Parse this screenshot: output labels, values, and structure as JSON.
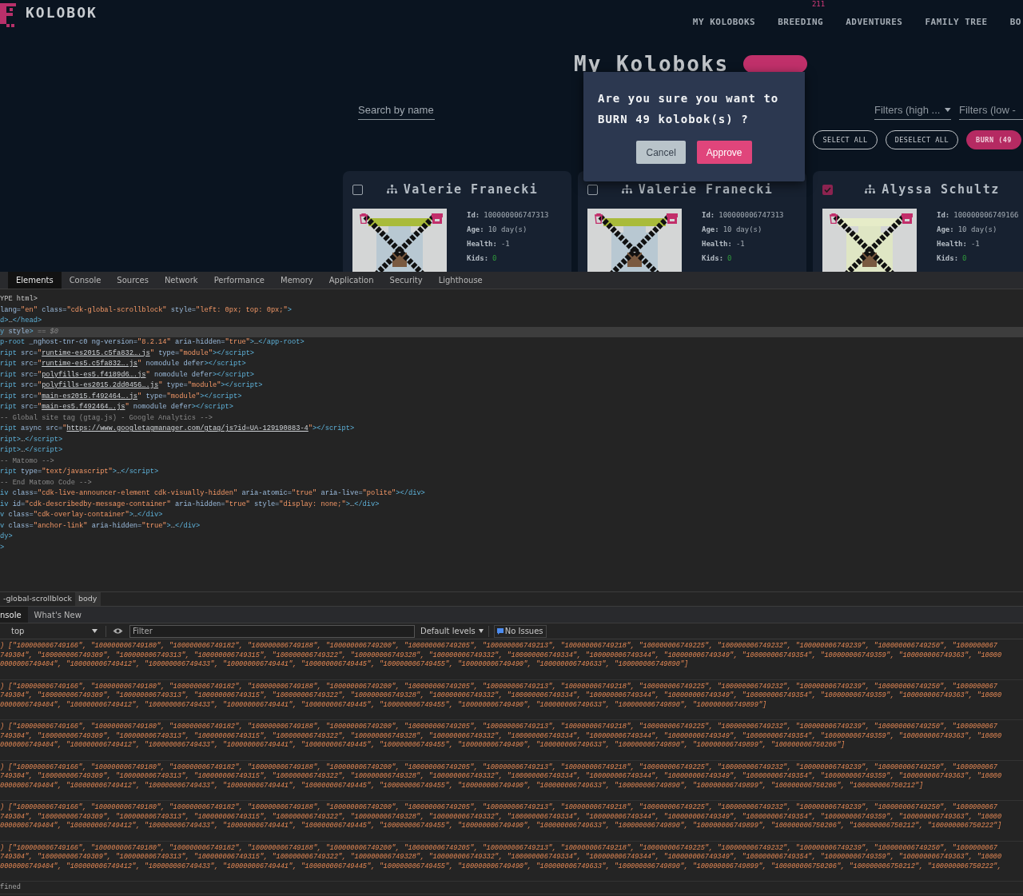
{
  "app": {
    "logo": "KOLOBOK",
    "nav": [
      {
        "label": "MY KOLOBOKS"
      },
      {
        "label": "BREEDING",
        "badge": "211"
      },
      {
        "label": "ADVENTURES"
      },
      {
        "label": "FAMILY TREE"
      },
      {
        "label": "BO"
      }
    ],
    "title": "My Koloboks",
    "search": {
      "placeholder": "Search by name"
    },
    "filters": [
      {
        "label": "Filters (high ..."
      },
      {
        "label": "Filters (low -"
      }
    ],
    "actions": [
      {
        "label": "SELECT ALL",
        "kind": "outline"
      },
      {
        "label": "DESELECT ALL",
        "kind": "outline"
      },
      {
        "label": "BURN (49",
        "kind": "filled"
      }
    ],
    "cards": [
      {
        "name": "Valerie Franecki",
        "checked": false,
        "stats": [
          {
            "label": "Id:",
            "value": "100000006747313",
            "kind": "text"
          },
          {
            "label": "Age:",
            "value": "10 day(s)",
            "kind": "text"
          },
          {
            "label": "Health:",
            "value": "-1",
            "kind": "text"
          },
          {
            "label": "Kids:",
            "value": "0",
            "kind": "count"
          }
        ]
      },
      {
        "name": "Valerie Franecki",
        "checked": false,
        "stats": [
          {
            "label": "Id:",
            "value": "100000006747313",
            "kind": "text"
          },
          {
            "label": "Age:",
            "value": "10 day(s)",
            "kind": "text"
          },
          {
            "label": "Health:",
            "value": "-1",
            "kind": "text"
          },
          {
            "label": "Kids:",
            "value": "0",
            "kind": "count"
          }
        ]
      },
      {
        "name": "Alyssa Schultz",
        "checked": true,
        "stats": [
          {
            "label": "Id:",
            "value": "100000006749166",
            "kind": "text"
          },
          {
            "label": "Age:",
            "value": "10 day(s)",
            "kind": "text"
          },
          {
            "label": "Health:",
            "value": "-1",
            "kind": "text"
          },
          {
            "label": "Kids:",
            "value": "0",
            "kind": "count"
          }
        ]
      }
    ],
    "dialog": {
      "message": "Are you sure you want to BURN 49 kolobok(s) ?",
      "buttons": [
        {
          "label": "Cancel",
          "kind": "secondary"
        },
        {
          "label": "Approve",
          "kind": "primary"
        }
      ]
    }
  },
  "devtools": {
    "tabs": [
      {
        "label": "Elements",
        "selected": true
      },
      {
        "label": "Console",
        "selected": false
      },
      {
        "label": "Sources",
        "selected": false
      },
      {
        "label": "Network",
        "selected": false
      },
      {
        "label": "Performance",
        "selected": false
      },
      {
        "label": "Memory",
        "selected": false
      },
      {
        "label": "Application",
        "selected": false
      },
      {
        "label": "Security",
        "selected": false
      },
      {
        "label": "Lighthouse",
        "selected": false
      }
    ],
    "dom_lines": [
      {
        "selected": false,
        "parts": [
          {
            "kind": "doctype",
            "text": "YPE html>"
          }
        ]
      },
      {
        "selected": false,
        "parts": [
          {
            "kind": "attr",
            "text": "lang="
          },
          {
            "kind": "value",
            "text": "\"en\""
          },
          {
            "kind": "attr",
            "text": " class="
          },
          {
            "kind": "value",
            "text": "\"cdk-global-scrollblock\""
          },
          {
            "kind": "attr",
            "text": " style="
          },
          {
            "kind": "value",
            "text": "\"left: 0px; top: 0px;\""
          },
          {
            "kind": "tag",
            "text": ">"
          }
        ]
      },
      {
        "selected": false,
        "parts": [
          {
            "kind": "tag",
            "text": "d>"
          },
          {
            "kind": "plain",
            "text": "…"
          },
          {
            "kind": "tag",
            "text": "</head>"
          }
        ]
      },
      {
        "selected": true,
        "parts": [
          {
            "kind": "tag",
            "text": "y"
          },
          {
            "kind": "attr",
            "text": " style"
          },
          {
            "kind": "tag",
            "text": ">"
          },
          {
            "kind": "comment",
            "text": " == $0"
          }
        ]
      },
      {
        "selected": false,
        "parts": [
          {
            "kind": "tag",
            "text": "p-root"
          },
          {
            "kind": "attr",
            "text": " _nghost-tnr-c0 ng-version="
          },
          {
            "kind": "value",
            "text": "\"8.2.14\""
          },
          {
            "kind": "attr",
            "text": " aria-hidden="
          },
          {
            "kind": "value",
            "text": "\"true\""
          },
          {
            "kind": "tag",
            "text": ">"
          },
          {
            "kind": "plain",
            "text": "…"
          },
          {
            "kind": "tag",
            "text": "</app-root>"
          }
        ]
      },
      {
        "selected": false,
        "parts": [
          {
            "kind": "tag",
            "text": "ript"
          },
          {
            "kind": "attr",
            "text": " src="
          },
          {
            "kind": "value",
            "text": "\""
          },
          {
            "kind": "link",
            "text": "runtime-es2015.c5fa832….js"
          },
          {
            "kind": "value",
            "text": "\""
          },
          {
            "kind": "attr",
            "text": " type="
          },
          {
            "kind": "value",
            "text": "\"module\""
          },
          {
            "kind": "tag",
            "text": "></script>"
          }
        ]
      },
      {
        "selected": false,
        "parts": [
          {
            "kind": "tag",
            "text": "ript"
          },
          {
            "kind": "attr",
            "text": " src="
          },
          {
            "kind": "value",
            "text": "\""
          },
          {
            "kind": "link",
            "text": "runtime-es5.c5fa832….js"
          },
          {
            "kind": "value",
            "text": "\""
          },
          {
            "kind": "attr",
            "text": " nomodule defer"
          },
          {
            "kind": "tag",
            "text": "></script>"
          }
        ]
      },
      {
        "selected": false,
        "parts": [
          {
            "kind": "tag",
            "text": "ript"
          },
          {
            "kind": "attr",
            "text": " src="
          },
          {
            "kind": "value",
            "text": "\""
          },
          {
            "kind": "link",
            "text": "polyfills-es5.f4189d6….js"
          },
          {
            "kind": "value",
            "text": "\""
          },
          {
            "kind": "attr",
            "text": " nomodule defer"
          },
          {
            "kind": "tag",
            "text": "></script>"
          }
        ]
      },
      {
        "selected": false,
        "parts": [
          {
            "kind": "tag",
            "text": "ript"
          },
          {
            "kind": "attr",
            "text": " src="
          },
          {
            "kind": "value",
            "text": "\""
          },
          {
            "kind": "link",
            "text": "polyfills-es2015.2dd0456….js"
          },
          {
            "kind": "value",
            "text": "\""
          },
          {
            "kind": "attr",
            "text": " type="
          },
          {
            "kind": "value",
            "text": "\"module\""
          },
          {
            "kind": "tag",
            "text": "></script>"
          }
        ]
      },
      {
        "selected": false,
        "parts": [
          {
            "kind": "tag",
            "text": "ript"
          },
          {
            "kind": "attr",
            "text": " src="
          },
          {
            "kind": "value",
            "text": "\""
          },
          {
            "kind": "link",
            "text": "main-es2015.f492464….js"
          },
          {
            "kind": "value",
            "text": "\""
          },
          {
            "kind": "attr",
            "text": " type="
          },
          {
            "kind": "value",
            "text": "\"module\""
          },
          {
            "kind": "tag",
            "text": "></script>"
          }
        ]
      },
      {
        "selected": false,
        "parts": [
          {
            "kind": "tag",
            "text": "ript"
          },
          {
            "kind": "attr",
            "text": " src="
          },
          {
            "kind": "value",
            "text": "\""
          },
          {
            "kind": "link",
            "text": "main-es5.f492464….js"
          },
          {
            "kind": "value",
            "text": "\""
          },
          {
            "kind": "attr",
            "text": " nomodule defer"
          },
          {
            "kind": "tag",
            "text": "></script>"
          }
        ]
      },
      {
        "selected": false,
        "parts": [
          {
            "kind": "comment",
            "text": "-- Global site tag (gtag.js) - Google Analytics -->"
          }
        ]
      },
      {
        "selected": false,
        "parts": [
          {
            "kind": "tag",
            "text": "ript"
          },
          {
            "kind": "attr",
            "text": " async src="
          },
          {
            "kind": "value",
            "text": "\""
          },
          {
            "kind": "link",
            "text": "https://www.googletagmanager.com/gtag/js?id=UA-129190883-4"
          },
          {
            "kind": "value",
            "text": "\""
          },
          {
            "kind": "tag",
            "text": "></script>"
          }
        ]
      },
      {
        "selected": false,
        "parts": [
          {
            "kind": "tag",
            "text": "ript>"
          },
          {
            "kind": "plain",
            "text": "…"
          },
          {
            "kind": "tag",
            "text": "</script>"
          }
        ]
      },
      {
        "selected": false,
        "parts": [
          {
            "kind": "tag",
            "text": "ript>"
          },
          {
            "kind": "plain",
            "text": "…"
          },
          {
            "kind": "tag",
            "text": "</script>"
          }
        ]
      },
      {
        "selected": false,
        "parts": [
          {
            "kind": "comment",
            "text": "-- Matomo -->"
          }
        ]
      },
      {
        "selected": false,
        "parts": [
          {
            "kind": "tag",
            "text": "ript"
          },
          {
            "kind": "attr",
            "text": " type="
          },
          {
            "kind": "value",
            "text": "\"text/javascript\""
          },
          {
            "kind": "tag",
            "text": ">"
          },
          {
            "kind": "plain",
            "text": "…"
          },
          {
            "kind": "tag",
            "text": "</script>"
          }
        ]
      },
      {
        "selected": false,
        "parts": [
          {
            "kind": "comment",
            "text": "-- End Matomo Code -->"
          }
        ]
      },
      {
        "selected": false,
        "parts": [
          {
            "kind": "tag",
            "text": "iv"
          },
          {
            "kind": "attr",
            "text": " class="
          },
          {
            "kind": "value",
            "text": "\"cdk-live-announcer-element cdk-visually-hidden\""
          },
          {
            "kind": "attr",
            "text": " aria-atomic="
          },
          {
            "kind": "value",
            "text": "\"true\""
          },
          {
            "kind": "attr",
            "text": " aria-live="
          },
          {
            "kind": "value",
            "text": "\"polite\""
          },
          {
            "kind": "tag",
            "text": "></div>"
          }
        ]
      },
      {
        "selected": false,
        "parts": [
          {
            "kind": "tag",
            "text": "iv"
          },
          {
            "kind": "attr",
            "text": " id="
          },
          {
            "kind": "value",
            "text": "\"cdk-describedby-message-container\""
          },
          {
            "kind": "attr",
            "text": " aria-hidden="
          },
          {
            "kind": "value",
            "text": "\"true\""
          },
          {
            "kind": "attr",
            "text": " style="
          },
          {
            "kind": "value",
            "text": "\"display: none;\""
          },
          {
            "kind": "tag",
            "text": ">"
          },
          {
            "kind": "plain",
            "text": "…"
          },
          {
            "kind": "tag",
            "text": "</div>"
          }
        ]
      },
      {
        "selected": false,
        "parts": [
          {
            "kind": "tag",
            "text": "v"
          },
          {
            "kind": "attr",
            "text": " class="
          },
          {
            "kind": "value",
            "text": "\"cdk-overlay-container\""
          },
          {
            "kind": "tag",
            "text": ">"
          },
          {
            "kind": "plain",
            "text": "…"
          },
          {
            "kind": "tag",
            "text": "</div>"
          }
        ]
      },
      {
        "selected": false,
        "parts": [
          {
            "kind": "tag",
            "text": "v"
          },
          {
            "kind": "attr",
            "text": " class="
          },
          {
            "kind": "value",
            "text": "\"anchor-link\""
          },
          {
            "kind": "attr",
            "text": " aria-hidden="
          },
          {
            "kind": "value",
            "text": "\"true\""
          },
          {
            "kind": "tag",
            "text": ">"
          },
          {
            "kind": "plain",
            "text": "…"
          },
          {
            "kind": "tag",
            "text": "</div>"
          }
        ]
      },
      {
        "selected": false,
        "parts": [
          {
            "kind": "tag",
            "text": "dy>"
          }
        ]
      },
      {
        "selected": false,
        "parts": [
          {
            "kind": "tag",
            "text": ">"
          }
        ]
      }
    ],
    "breadcrumbs": [
      {
        "label": "-global-scrollblock",
        "selected": false
      },
      {
        "label": "body",
        "selected": true
      }
    ],
    "drawer_tabs": [
      {
        "label": "nsole",
        "selected": true
      },
      {
        "label": "What's New",
        "selected": false
      }
    ],
    "console_toolbar": {
      "context": "top",
      "filter_placeholder": "Filter",
      "levels": "Default levels",
      "issues": "No Issues"
    },
    "messages": [
      {
        "lines": [
          ") [\"100000006749166\", \"100000006749180\", \"100000006749182\", \"100000006749188\", \"100000006749200\", \"100000006749205\", \"100000006749213\", \"100000006749218\", \"100000006749225\", \"100000006749232\", \"100000006749239\", \"100000006749250\", \"1000000067",
          "749304\", \"100000006749309\", \"100000006749313\", \"100000006749315\", \"100000006749322\", \"100000006749328\", \"100000006749332\", \"100000006749334\", \"100000006749344\", \"100000006749349\", \"100000006749354\", \"100000006749359\", \"100000006749363\", \"10000",
          "0000006749404\", \"100000006749412\", \"100000006749433\", \"100000006749441\", \"100000006749445\", \"100000006749455\", \"100000006749490\", \"100000006749633\", \"100000006749890\"]"
        ]
      },
      {
        "lines": [
          ") [\"100000006749166\", \"100000006749180\", \"100000006749182\", \"100000006749188\", \"100000006749200\", \"100000006749205\", \"100000006749213\", \"100000006749218\", \"100000006749225\", \"100000006749232\", \"100000006749239\", \"100000006749250\", \"1000000067",
          "749304\", \"100000006749309\", \"100000006749313\", \"100000006749315\", \"100000006749322\", \"100000006749328\", \"100000006749332\", \"100000006749334\", \"100000006749344\", \"100000006749349\", \"100000006749354\", \"100000006749359\", \"100000006749363\", \"10000",
          "0000006749404\", \"100000006749412\", \"100000006749433\", \"100000006749441\", \"100000006749445\", \"100000006749455\", \"100000006749490\", \"100000006749633\", \"100000006749890\", \"100000006749899\"]"
        ]
      },
      {
        "lines": [
          ") [\"100000006749166\", \"100000006749180\", \"100000006749182\", \"100000006749188\", \"100000006749200\", \"100000006749205\", \"100000006749213\", \"100000006749218\", \"100000006749225\", \"100000006749232\", \"100000006749239\", \"100000006749250\", \"1000000067",
          "749304\", \"100000006749309\", \"100000006749313\", \"100000006749315\", \"100000006749322\", \"100000006749328\", \"100000006749332\", \"100000006749334\", \"100000006749344\", \"100000006749349\", \"100000006749354\", \"100000006749359\", \"100000006749363\", \"10000",
          "0000006749404\", \"100000006749412\", \"100000006749433\", \"100000006749441\", \"100000006749445\", \"100000006749455\", \"100000006749490\", \"100000006749633\", \"100000006749890\", \"100000006749899\", \"100000006750206\"]"
        ]
      },
      {
        "lines": [
          ") [\"100000006749166\", \"100000006749180\", \"100000006749182\", \"100000006749188\", \"100000006749200\", \"100000006749205\", \"100000006749213\", \"100000006749218\", \"100000006749225\", \"100000006749232\", \"100000006749239\", \"100000006749250\", \"1000000067",
          "749304\", \"100000006749309\", \"100000006749313\", \"100000006749315\", \"100000006749322\", \"100000006749328\", \"100000006749332\", \"100000006749334\", \"100000006749344\", \"100000006749349\", \"100000006749354\", \"100000006749359\", \"100000006749363\", \"10000",
          "0000006749404\", \"100000006749412\", \"100000006749433\", \"100000006749441\", \"100000006749445\", \"100000006749455\", \"100000006749490\", \"100000006749633\", \"100000006749890\", \"100000006749899\", \"100000006750206\", \"100000006750212\"]"
        ]
      },
      {
        "lines": [
          ") [\"100000006749166\", \"100000006749180\", \"100000006749182\", \"100000006749188\", \"100000006749200\", \"100000006749205\", \"100000006749213\", \"100000006749218\", \"100000006749225\", \"100000006749232\", \"100000006749239\", \"100000006749250\", \"1000000067",
          "749304\", \"100000006749309\", \"100000006749313\", \"100000006749315\", \"100000006749322\", \"100000006749328\", \"100000006749332\", \"100000006749334\", \"100000006749344\", \"100000006749349\", \"100000006749354\", \"100000006749359\", \"100000006749363\", \"10000",
          "0000006749404\", \"100000006749412\", \"100000006749433\", \"100000006749441\", \"100000006749445\", \"100000006749455\", \"100000006749490\", \"100000006749633\", \"100000006749890\", \"100000006749899\", \"100000006750206\", \"100000006750212\", \"100000006750222\"]"
        ]
      },
      {
        "lines": [
          ") [\"100000006749166\", \"100000006749180\", \"100000006749182\", \"100000006749188\", \"100000006749200\", \"100000006749205\", \"100000006749213\", \"100000006749218\", \"100000006749225\", \"100000006749232\", \"100000006749239\", \"100000006749250\", \"1000000067",
          "749304\", \"100000006749309\", \"100000006749313\", \"100000006749315\", \"100000006749322\", \"100000006749328\", \"100000006749332\", \"100000006749334\", \"100000006749344\", \"100000006749349\", \"100000006749354\", \"100000006749359\", \"100000006749363\", \"10000",
          "0000006749404\", \"100000006749412\", \"100000006749433\", \"100000006749441\", \"100000006749445\", \"100000006749455\", \"100000006749490\", \"100000006749633\", \"100000006749890\", \"100000006749899\", \"100000006750206\", \"100000006750212\", \"100000006750222\","
        ]
      }
    ],
    "last_line": "fined"
  }
}
